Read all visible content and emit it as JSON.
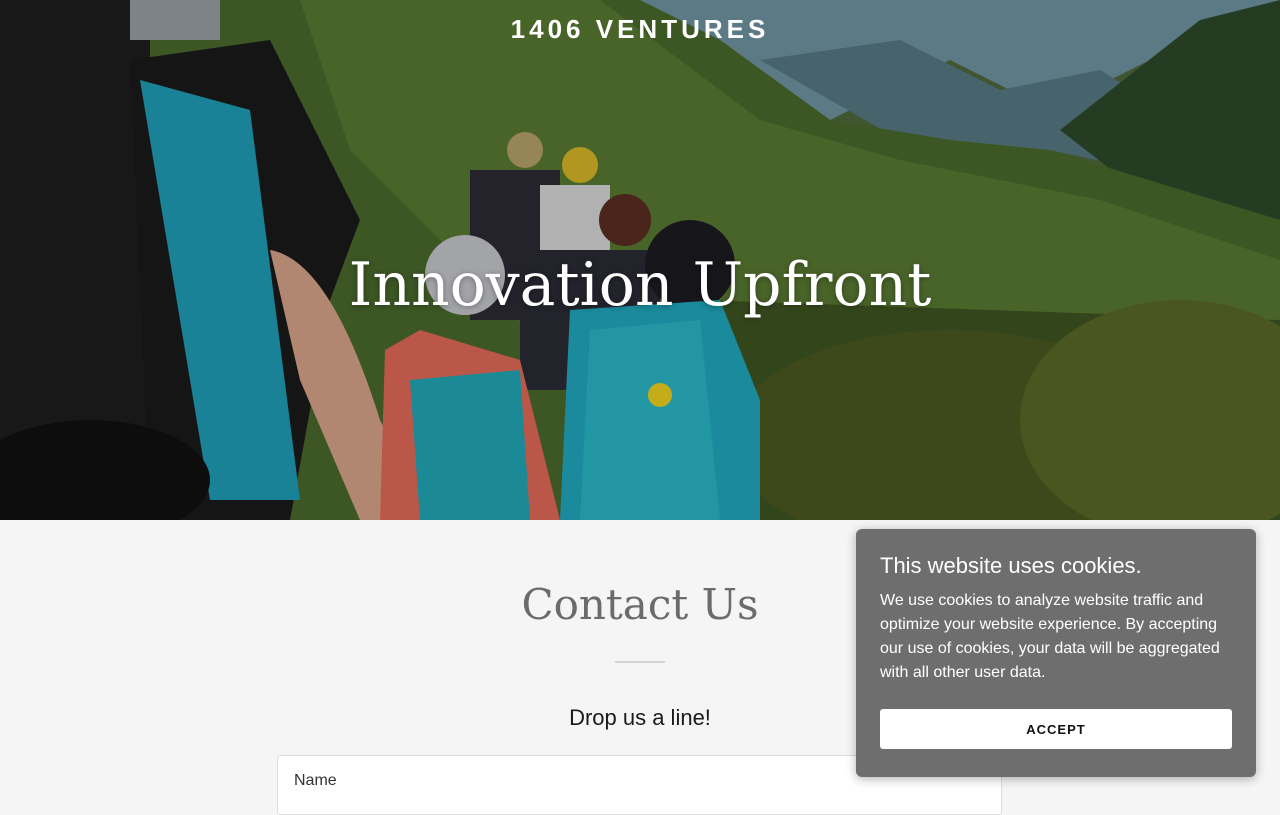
{
  "header": {
    "brand": "1406 VENTURES"
  },
  "hero": {
    "headline": "Innovation Upfront",
    "image": "hikers-on-mountain-ridge"
  },
  "contact": {
    "title": "Contact Us",
    "subtitle": "Drop us a line!",
    "form": {
      "name_label": "Name"
    }
  },
  "cookie_banner": {
    "title": "This website uses cookies.",
    "body": "We use cookies to analyze website traffic and optimize your website experience. By accepting our use of cookies, your data will be aggregated with all other user data.",
    "accept_label": "ACCEPT"
  },
  "colors": {
    "page_background": "#f5f5f5",
    "banner_background": "#6e6e6e",
    "heading_gray": "#6b6b6b"
  }
}
